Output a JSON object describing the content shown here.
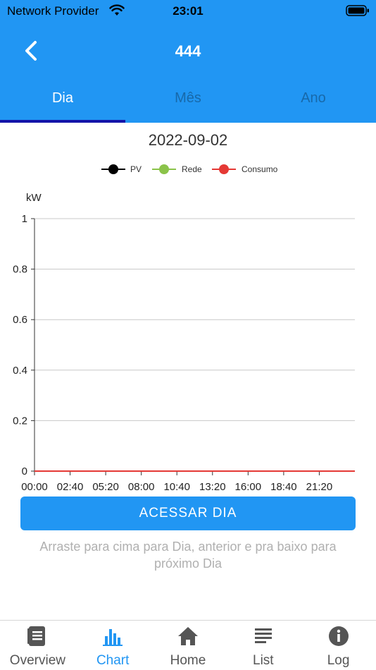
{
  "status_bar": {
    "carrier": "Network Provider",
    "time": "23:01"
  },
  "header": {
    "title": "444",
    "back_icon": "chevron-left-icon"
  },
  "tabs": [
    {
      "label": "Dia",
      "active": true
    },
    {
      "label": "Mês",
      "active": false
    },
    {
      "label": "Ano",
      "active": false
    }
  ],
  "chart_date": "2022-09-02",
  "chart_data": {
    "type": "line",
    "title": "",
    "ylabel": "kW",
    "xlabel": "",
    "x": [
      "00:00",
      "02:40",
      "05:20",
      "08:00",
      "10:40",
      "13:20",
      "16:00",
      "18:40",
      "21:20"
    ],
    "y_ticks": [
      "0",
      "0.2",
      "0.4",
      "0.6",
      "0.8",
      "1"
    ],
    "ylim": [
      0,
      1
    ],
    "grid": true,
    "legend_position": "top-center",
    "series": [
      {
        "name": "PV",
        "color": "#000000",
        "values": [
          0,
          0,
          0,
          0,
          0,
          0,
          0,
          0,
          0
        ]
      },
      {
        "name": "Rede",
        "color": "#8bc34a",
        "values": [
          0,
          0,
          0,
          0,
          0,
          0,
          0,
          0,
          0
        ]
      },
      {
        "name": "Consumo",
        "color": "#e53935",
        "values": [
          0,
          0,
          0,
          0,
          0,
          0,
          0,
          0,
          0
        ]
      }
    ]
  },
  "action_button": {
    "label": "ACESSAR DIA"
  },
  "hint": "Arraste para cima para Dia, anterior e pra baixo para próximo Dia",
  "bottom_nav": [
    {
      "label": "Overview",
      "icon": "document-icon",
      "active": false
    },
    {
      "label": "Chart",
      "icon": "bar-chart-icon",
      "active": true
    },
    {
      "label": "Home",
      "icon": "home-icon",
      "active": false
    },
    {
      "label": "List",
      "icon": "list-icon",
      "active": false
    },
    {
      "label": "Log",
      "icon": "info-icon",
      "active": false
    }
  ],
  "colors": {
    "primary": "#2196f3",
    "tab_indicator": "#1414a8",
    "inactive_tab": "#6b6b6b",
    "nav_active": "#2196f3"
  }
}
